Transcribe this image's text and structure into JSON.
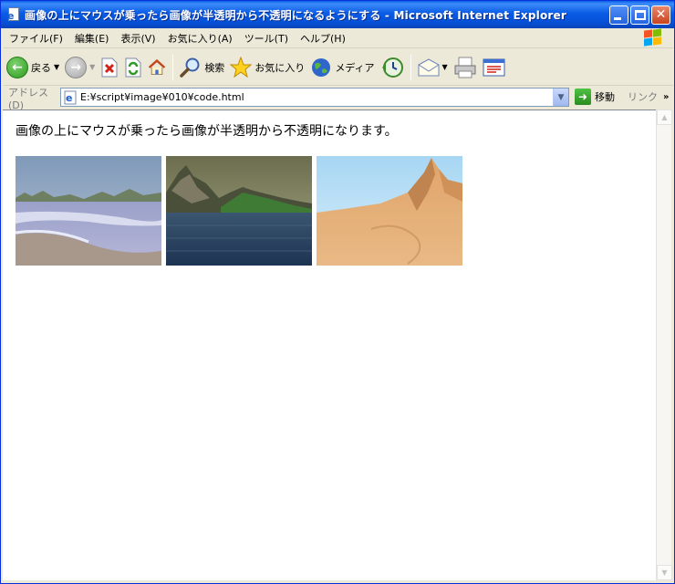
{
  "window": {
    "title": "画像の上にマウスが乗ったら画像が半透明から不透明になるようにする - Microsoft Internet Explorer"
  },
  "menubar": {
    "items": [
      "ファイル(F)",
      "編集(E)",
      "表示(V)",
      "お気に入り(A)",
      "ツール(T)",
      "ヘルプ(H)"
    ]
  },
  "toolbar": {
    "back_label": "戻る",
    "search_label": "検索",
    "favorites_label": "お気に入り",
    "media_label": "メディア"
  },
  "addressbar": {
    "label": "アドレス(D)",
    "url": "E:¥script¥image¥010¥code.html",
    "go_label": "移動",
    "links_label": "リンク",
    "links_more": "»"
  },
  "page": {
    "text": "画像の上にマウスが乗ったら画像が半透明から不透明になります。",
    "images": [
      {
        "scene": "beach"
      },
      {
        "scene": "sea-mountain"
      },
      {
        "scene": "desert-mountain"
      }
    ]
  },
  "colors": {
    "titlebar": "#0a5ce6",
    "chrome": "#ece9d8",
    "content_bg": "#ffffff"
  }
}
